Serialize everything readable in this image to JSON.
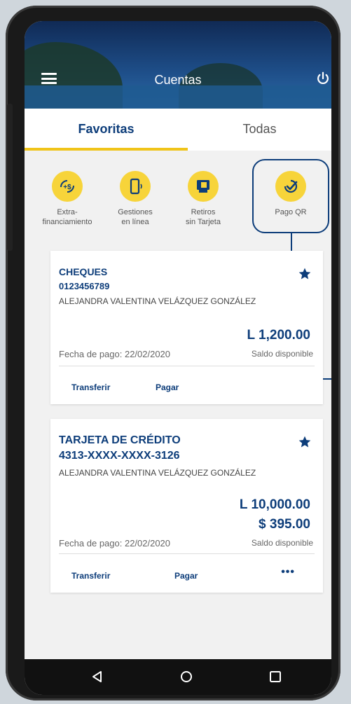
{
  "header": {
    "title": "Cuentas"
  },
  "tabs": [
    {
      "label": "Favoritas"
    },
    {
      "label": "Todas"
    }
  ],
  "quick_actions": [
    {
      "label": "Extra-\nfinanciamiento",
      "icon": "money-plus-icon"
    },
    {
      "label": "Gestiones\nen línea",
      "icon": "phone-icon"
    },
    {
      "label": "Retiros\nsin Tarjeta",
      "icon": "atm-phone-icon"
    },
    {
      "label": "Pago QR",
      "icon": "qr-check-icon"
    }
  ],
  "accounts": [
    {
      "type": "CHEQUES",
      "number": "0123456789",
      "holder": "ALEJANDRA VALENTINA VELÁZQUEZ GONZÁLEZ",
      "amounts": [
        "L 1,200.00"
      ],
      "balance_label": "Saldo disponible",
      "due": "Fecha de pago: 22/02/2020",
      "actions": [
        "Transferir",
        "Pagar"
      ]
    },
    {
      "type": "TARJETA DE CRÉDITO",
      "number": "4313-XXXX-XXXX-3126",
      "holder": "ALEJANDRA VALENTINA VELÁZQUEZ GONZÁLEZ",
      "amounts": [
        "L 10,000.00",
        "$ 395.00"
      ],
      "balance_label": "Saldo disponible",
      "due": "Fecha de pago: 22/02/2020",
      "actions": [
        "Transferir",
        "Pagar",
        "•••"
      ]
    }
  ],
  "colors": {
    "brand": "#0d3d7a",
    "accent": "#f0c419"
  }
}
